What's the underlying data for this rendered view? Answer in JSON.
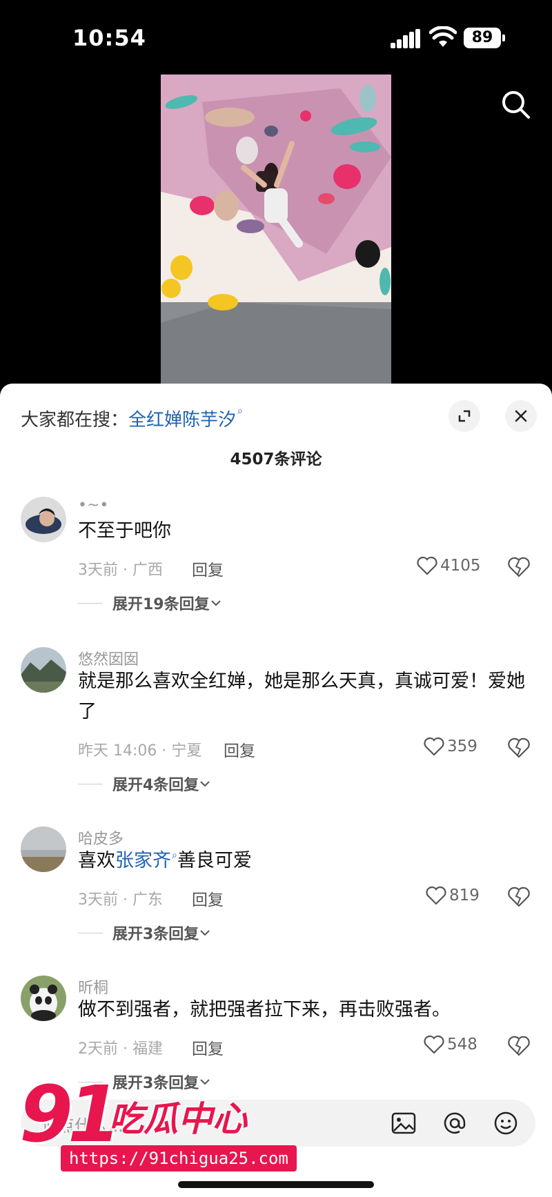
{
  "status_bar": {
    "time": "10:54",
    "battery": "89"
  },
  "colors": {
    "accent_link": "#1f62b5",
    "watermark_red": "#e8164e"
  },
  "hot_search": {
    "label": "大家都在搜：",
    "query": "全红婵陈芋汐"
  },
  "comment_count": "4507条评论",
  "comments": [
    {
      "username": "•~•",
      "text": "不至于吧你",
      "time_location": "3天前 · 广西",
      "reply_label": "回复",
      "likes": "4105",
      "expand_label": "展开19条回复"
    },
    {
      "username": "悠然囡囡",
      "text": "就是那么喜欢全红婵，她是那么天真，真诚可爱！爱她了",
      "time_location": "昨天 14:06 · 宁夏",
      "reply_label": "回复",
      "likes": "359",
      "expand_label": "展开4条回复"
    },
    {
      "username": "哈皮多",
      "text_prefix": "喜欢",
      "text_keyword": "张家齐",
      "text_suffix": "善良可爱",
      "time_location": "3天前 · 广东",
      "reply_label": "回复",
      "likes": "819",
      "expand_label": "展开3条回复"
    },
    {
      "username": "昕桐",
      "text": "做不到强者，就把强者拉下来，再击败强者。",
      "time_location": "2天前 · 福建",
      "reply_label": "回复",
      "likes": "548",
      "expand_label": "展开3条回复"
    }
  ],
  "input": {
    "placeholder": "说点什么..."
  },
  "icons": [
    "search-icon",
    "expand-icon",
    "close-icon",
    "heart-icon",
    "broken-heart-icon",
    "chevron-down-icon",
    "image-icon",
    "at-icon",
    "emoji-icon"
  ],
  "watermark": {
    "number": "91",
    "name": "吃瓜中心",
    "url": "https://91chigua25.com"
  }
}
